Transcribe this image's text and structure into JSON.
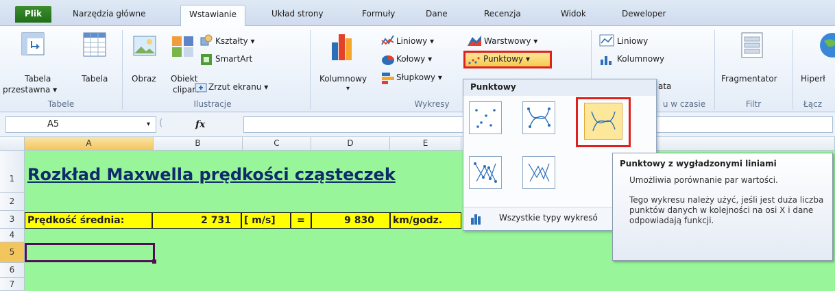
{
  "tabs": [
    {
      "label": "Plik"
    },
    {
      "label": "Narzędzia główne"
    },
    {
      "label": "Wstawianie"
    },
    {
      "label": "Układ strony"
    },
    {
      "label": "Formuły"
    },
    {
      "label": "Dane"
    },
    {
      "label": "Recenzja"
    },
    {
      "label": "Widok"
    },
    {
      "label": "Deweloper"
    }
  ],
  "active_tab": "Wstawianie",
  "ribbon": {
    "tabele": {
      "label": "Tabele",
      "tabela_przestawna": [
        "Tabela",
        "przestawna ▾"
      ],
      "tabela": "Tabela"
    },
    "ilustracje": {
      "label": "Ilustracje",
      "obraz": "Obraz",
      "obiekt_clipart": [
        "Obiekt",
        "clipart"
      ],
      "ksztalty": "Kształty ▾",
      "smartart": "SmartArt",
      "zrzut": "Zrzut ekranu ▾"
    },
    "wykresy": {
      "label": "Wykresy",
      "kolumnowy": "Kolumnowy",
      "liniowy": "Liniowy ▾",
      "kolowy": "Kołowy ▾",
      "slupkowy": "Słupkowy ▾",
      "warstwowy": "Warstwowy ▾",
      "punktowy": "Punktowy ▾"
    },
    "wykresy_przebiegu": {
      "label_partial": "u w czasie",
      "liniowy": "Liniowy",
      "kolumnowy": "Kolumnowy",
      "partial": "ata"
    },
    "filtr": {
      "label": "Filtr",
      "fragmentator": "Fragmentator"
    },
    "lacza": {
      "label": "Łącz",
      "hiperlacze": "Hiperł"
    }
  },
  "formula_bar": {
    "name_box": "A5",
    "fx": "fx",
    "value": ""
  },
  "columns": [
    "A",
    "B",
    "C",
    "D",
    "E"
  ],
  "rows": [
    "1",
    "2",
    "3",
    "4",
    "5",
    "6",
    "7"
  ],
  "cells": {
    "title": "Rozkład Maxwella prędkości cząsteczek",
    "label": "Prędkość średnia:",
    "value_ms": "2 731",
    "unit_ms": "[ m/s]",
    "equals": "=",
    "value_kmh": "9 830",
    "unit_kmh": "km/godz."
  },
  "dropdown": {
    "header": "Punktowy",
    "footer": "Wszystkie typy wykresó"
  },
  "tooltip": {
    "title": "Punktowy z wygładzonymi liniami",
    "line1": "Umożliwia porównanie par wartości.",
    "line2": "Tego wykresu należy użyć, jeśli jest duża liczba punktów danych w kolejności na osi X i dane odpowiadają funkcji."
  },
  "colors": {
    "sheet_bg": "#99f599",
    "highlight": "#ffff00",
    "callout_red": "#e0201c",
    "file_tab": "#2e7d24"
  }
}
